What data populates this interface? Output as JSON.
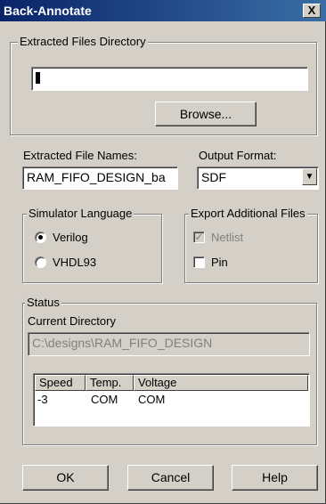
{
  "window": {
    "title": "Back-Annotate",
    "close_glyph": "X"
  },
  "extracted_dir": {
    "group_label": "Extracted Files Directory",
    "value": "",
    "browse_label": "Browse..."
  },
  "names": {
    "label": "Extracted File Names:",
    "value": "RAM_FIFO_DESIGN_ba"
  },
  "output_format": {
    "label": "Output Format:",
    "selected": "SDF",
    "arrow_glyph": "▼"
  },
  "simulator": {
    "group_label": "Simulator Language",
    "options": [
      {
        "label": "Verilog",
        "checked": true
      },
      {
        "label": "VHDL93",
        "checked": false
      }
    ]
  },
  "export": {
    "group_label": "Export Additional Files",
    "items": [
      {
        "label": "Netlist",
        "checked": true,
        "disabled": true
      },
      {
        "label": "Pin",
        "checked": false,
        "disabled": false
      }
    ],
    "check_glyph": "✓"
  },
  "status": {
    "group_label": "Status",
    "current_dir_label": "Current Directory",
    "current_dir_value": "C:\\designs\\RAM_FIFO_DESIGN",
    "columns": [
      "Speed",
      "Temp.",
      "Voltage"
    ],
    "rows": [
      [
        "-3",
        "COM",
        "COM"
      ]
    ]
  },
  "buttons": {
    "ok": "OK",
    "cancel": "Cancel",
    "help": "Help"
  }
}
